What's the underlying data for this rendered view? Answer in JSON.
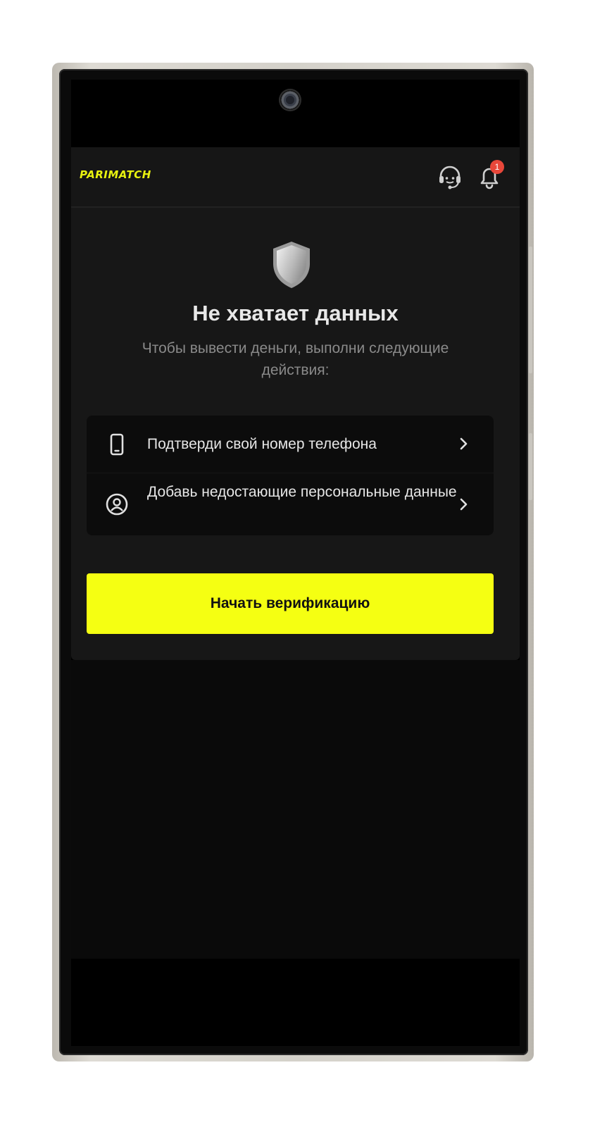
{
  "app": {
    "logo_text": "PARIMATCH",
    "brand_color": "#e8f20f"
  },
  "header": {
    "support_icon": "headset-icon",
    "notifications_icon": "bell-icon",
    "notifications_count": "1"
  },
  "main": {
    "hero_icon": "shield-icon",
    "title": "Не хватает данных",
    "subtitle": "Чтобы вывести деньги, выполни следующие действия:",
    "actions": [
      {
        "icon": "phone-icon",
        "label": "Подтверди свой номер телефона"
      },
      {
        "icon": "user-circle-icon",
        "label": "Добавь недостающие персональные данные"
      }
    ],
    "primary_button": "Начать верификацию",
    "accent_color": "#f5ff12"
  }
}
